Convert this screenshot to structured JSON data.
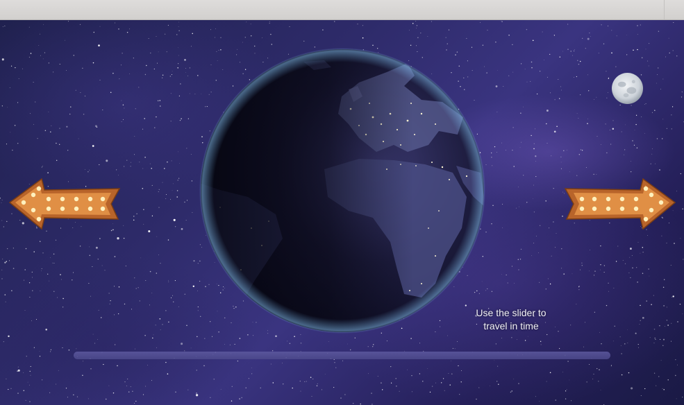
{
  "window": {
    "title_bar_color": "#d9d7d6"
  },
  "scene": {
    "background_color": "#2a2862",
    "earth_icon": "earth-night-globe",
    "moon_icon": "full-moon"
  },
  "navigation": {
    "prev_icon": "marquee-arrow-left-icon",
    "next_icon": "marquee-arrow-right-icon",
    "arrow_color": "#d9883a",
    "bulb_color": "#fff3c4"
  },
  "hint": {
    "line1": "Use the slider to",
    "line2": "travel in time"
  },
  "time_slider": {
    "track_color": "#5a5699"
  }
}
